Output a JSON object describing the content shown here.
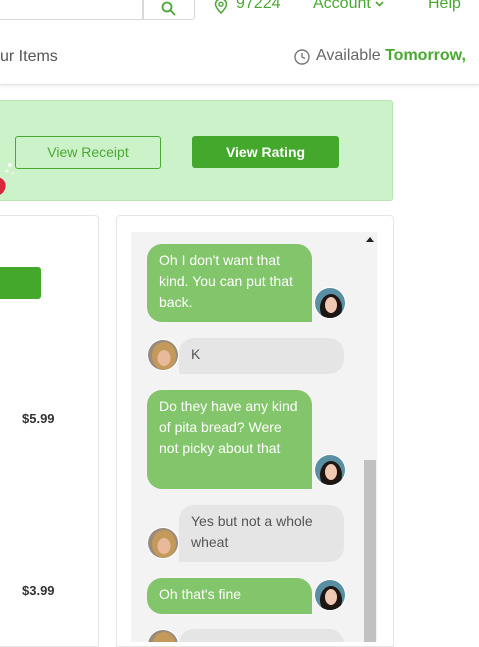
{
  "topbar": {
    "zip": "97224",
    "account_label": "Account",
    "help_label": "Help",
    "icons": {
      "search": "search-icon",
      "location": "map-pin-icon",
      "chevron": "chevron-down-icon"
    }
  },
  "subheader": {
    "items_label": "ur Items",
    "available_label": "Available",
    "available_day": "Tomorrow,"
  },
  "banner": {
    "view_receipt_label": "View Receipt",
    "view_rating_label": "View Rating"
  },
  "left_panel": {
    "prices": [
      "$5.99",
      "$3.99"
    ]
  },
  "chat": {
    "messages": [
      {
        "from": "shopper",
        "text": "Oh I don't want that kind. You can put that back."
      },
      {
        "from": "customer",
        "text": "K"
      },
      {
        "from": "shopper",
        "text": "Do they have any kind of pita bread? Were not picky about that"
      },
      {
        "from": "customer",
        "text": "Yes but not a whole wheat"
      },
      {
        "from": "shopper",
        "text": "Oh that's fine"
      }
    ]
  },
  "colors": {
    "accent": "#4aa832",
    "button_green": "#43a82c",
    "banner_bg": "#ccf2c9",
    "outgoing_bubble": "#82c56b",
    "incoming_bubble": "#e5e5e5"
  }
}
